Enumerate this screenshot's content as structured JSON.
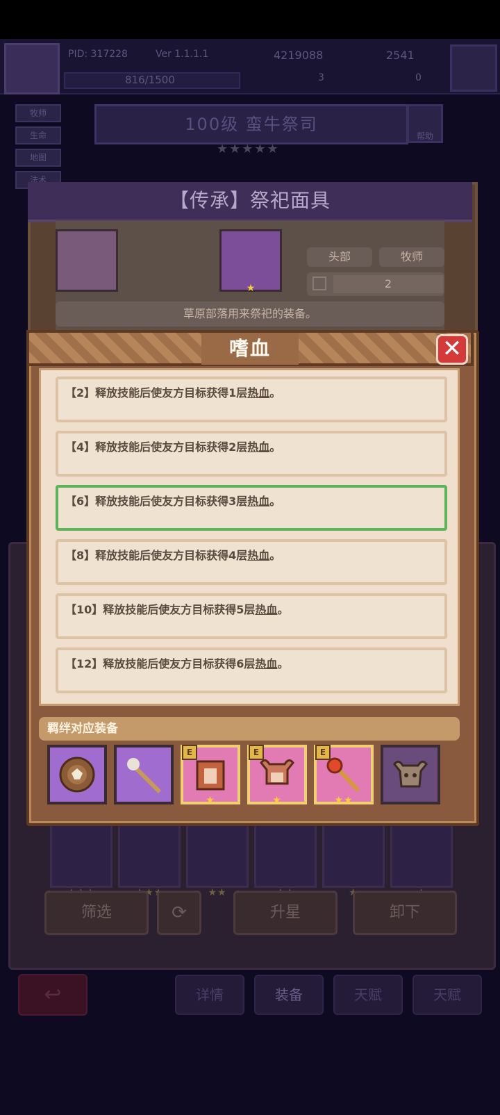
{
  "hud": {
    "pid": "PID: 317228",
    "version": "Ver 1.1.1.1",
    "gold": "4219088",
    "gems": "2541",
    "exp": "816/1500",
    "count_a": "3",
    "count_b": "0"
  },
  "side_tabs": [
    "牧师",
    "生命",
    "地图",
    "法术"
  ],
  "hero": {
    "title": "100级 蛮牛祭司",
    "stars": "★★★★★",
    "help_label": "帮助"
  },
  "item": {
    "title": "【传承】祭祀面具",
    "slot_tag": "头部",
    "class_tag": "牧师",
    "count": "2",
    "description": "草原部落用来祭祀的装备。",
    "icon_stars": "★"
  },
  "modal": {
    "title": "嗜血",
    "close_label": "✕",
    "bond_tiers": [
      {
        "tier": "【2】",
        "text": "释放技能后使友方目标获得1层",
        "keyword": "热血",
        "tail": "。"
      },
      {
        "tier": "【4】",
        "text": "释放技能后使友方目标获得2层",
        "keyword": "热血",
        "tail": "。"
      },
      {
        "tier": "【6】",
        "text": "释放技能后使友方目标获得3层",
        "keyword": "热血",
        "tail": "。"
      },
      {
        "tier": "【8】",
        "text": "释放技能后使友方目标获得4层",
        "keyword": "热血",
        "tail": "。"
      },
      {
        "tier": "【10】",
        "text": "释放技能后使友方目标获得5层",
        "keyword": "热血",
        "tail": "。"
      },
      {
        "tier": "【12】",
        "text": "释放技能后使友方目标获得6层",
        "keyword": "热血",
        "tail": "。"
      }
    ],
    "equip_label": "羁绊对应装备",
    "equipment": [
      {
        "icon": "bull-shield-icon",
        "badge": "",
        "stars": ""
      },
      {
        "icon": "staff-icon",
        "badge": "",
        "stars": ""
      },
      {
        "icon": "bull-armor-icon",
        "badge": "E",
        "stars": "★"
      },
      {
        "icon": "bull-mask-icon",
        "badge": "E",
        "stars": "★"
      },
      {
        "icon": "scepter-icon",
        "badge": "E",
        "stars": "★★"
      },
      {
        "icon": "bull-skull-icon",
        "badge": "",
        "stars": ""
      }
    ]
  },
  "background_slots": [
    {
      "icon": "hood-icon",
      "stars": "★★★"
    },
    {
      "icon": "helm-icon",
      "stars": "★★★"
    },
    {
      "icon": "knight-helm-icon",
      "stars": "★★"
    },
    {
      "icon": "crown-icon",
      "stars": "★★"
    },
    {
      "icon": "orb-helm-icon",
      "stars": "★"
    },
    {
      "icon": "iron-helm-icon",
      "stars": "★"
    }
  ],
  "buttons": {
    "filter": "筛选",
    "upgrade": "升星",
    "unequip": "卸下"
  },
  "bottom_nav": [
    "详情",
    "装备",
    "天赋",
    "天赋"
  ],
  "colors": {
    "active_border": "#5cb35a",
    "close_red": "#d53a3a",
    "star_gold": "#f6cf3a"
  }
}
